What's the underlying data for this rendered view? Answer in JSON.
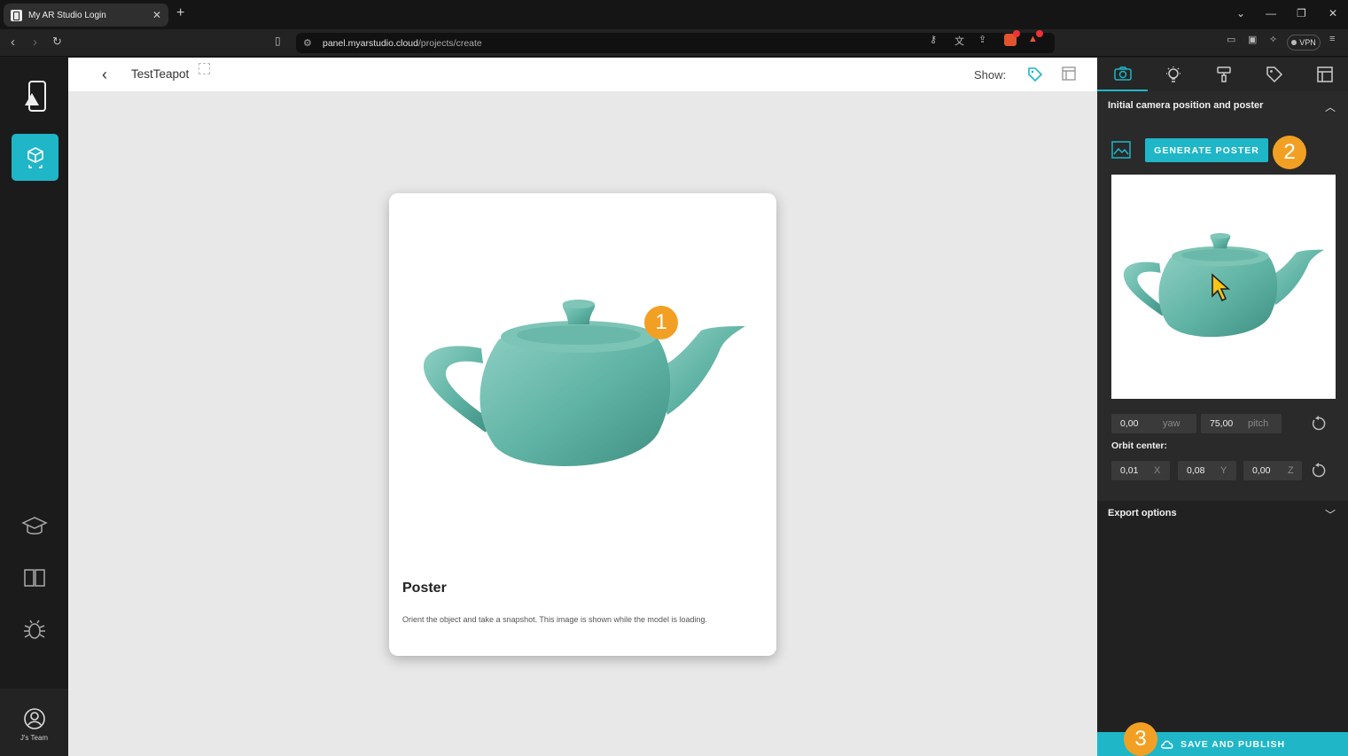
{
  "browser": {
    "tab_title": "My AR Studio Login",
    "new_tab": "+",
    "url_host": "panel.myarstudio.cloud",
    "url_path": "/projects/create",
    "vpn_label": "VPN"
  },
  "app": {
    "project_name": "TestTeapot",
    "show_label": "Show:",
    "team_label": "J's Team",
    "accent": "#1fb6c8"
  },
  "poster_card": {
    "title": "Poster",
    "description": "Orient the object and take a snapshot. This image is shown while the model is loading."
  },
  "panel": {
    "camera_section_title": "Initial camera position and poster",
    "generate_poster_label": "GENERATE POSTER",
    "yaw_value": "0,00",
    "yaw_unit": "yaw",
    "pitch_value": "75,00",
    "pitch_unit": "pitch",
    "orbit_center_label": "Orbit center:",
    "orbit_x": "0,01",
    "orbit_x_unit": "X",
    "orbit_y": "0,08",
    "orbit_y_unit": "Y",
    "orbit_z": "0,00",
    "orbit_z_unit": "Z",
    "export_section_title": "Export options",
    "save_publish_label": "SAVE AND PUBLISH"
  },
  "annotations": {
    "step1": "1",
    "step2": "2",
    "step3": "3",
    "badge_color": "#f2a023"
  },
  "icons": {
    "tabs": [
      "camera-icon",
      "light-icon",
      "paint-roller-icon",
      "tag-icon",
      "options-icon"
    ],
    "sidebar": [
      "ar-cube-icon",
      "graduation-cap-icon",
      "book-icon",
      "bug-icon",
      "user-icon"
    ]
  }
}
